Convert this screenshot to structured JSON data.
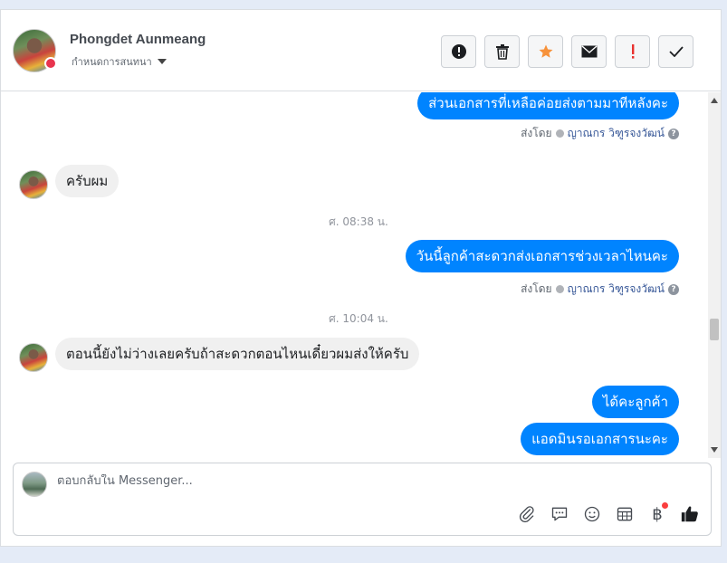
{
  "header": {
    "name": "Phongdet Aunmeang",
    "subtitle": "กำหนดการสนทนา",
    "actions": [
      {
        "name": "spam-button",
        "icon": "alert-circle-icon"
      },
      {
        "name": "delete-button",
        "icon": "trash-icon"
      },
      {
        "name": "star-button",
        "icon": "star-icon"
      },
      {
        "name": "mark-unread-button",
        "icon": "envelope-icon"
      },
      {
        "name": "follow-up-button",
        "icon": "exclamation-icon"
      },
      {
        "name": "done-button",
        "icon": "check-icon"
      }
    ]
  },
  "thread": {
    "msg1": "ส่วนเอกสารที่เหลือค่อยส่งตามมาทีหลังคะ",
    "sent_prefix": "ส่งโดย",
    "agent_name": "ญาณกร วิฑูรจงวัฒน์",
    "help": "?",
    "msg2": "ครับผม",
    "time1": "ศ. 08:38 น.",
    "msg3": "วันนี้ลูกค้าสะดวกส่งเอกสารช่วงเวลาไหนคะ",
    "time2": "ศ. 10:04 น.",
    "msg4": "ตอนนี้ยังไม่ว่างเลยครับถ้าสะดวกตอนไหนเดี๋ยวผมส่งให้ครับ",
    "msg5": "ได้คะลูกค้า",
    "msg6": "แอดมินรอเอกสารนะคะ"
  },
  "composer": {
    "placeholder": "ตอบกลับใน Messenger...",
    "value": "",
    "baht_symbol": "฿"
  },
  "colors": {
    "outgoing": "#0084ff",
    "incoming": "#f0f0f0",
    "star": "#f7923b",
    "alert": "#e9322f"
  }
}
